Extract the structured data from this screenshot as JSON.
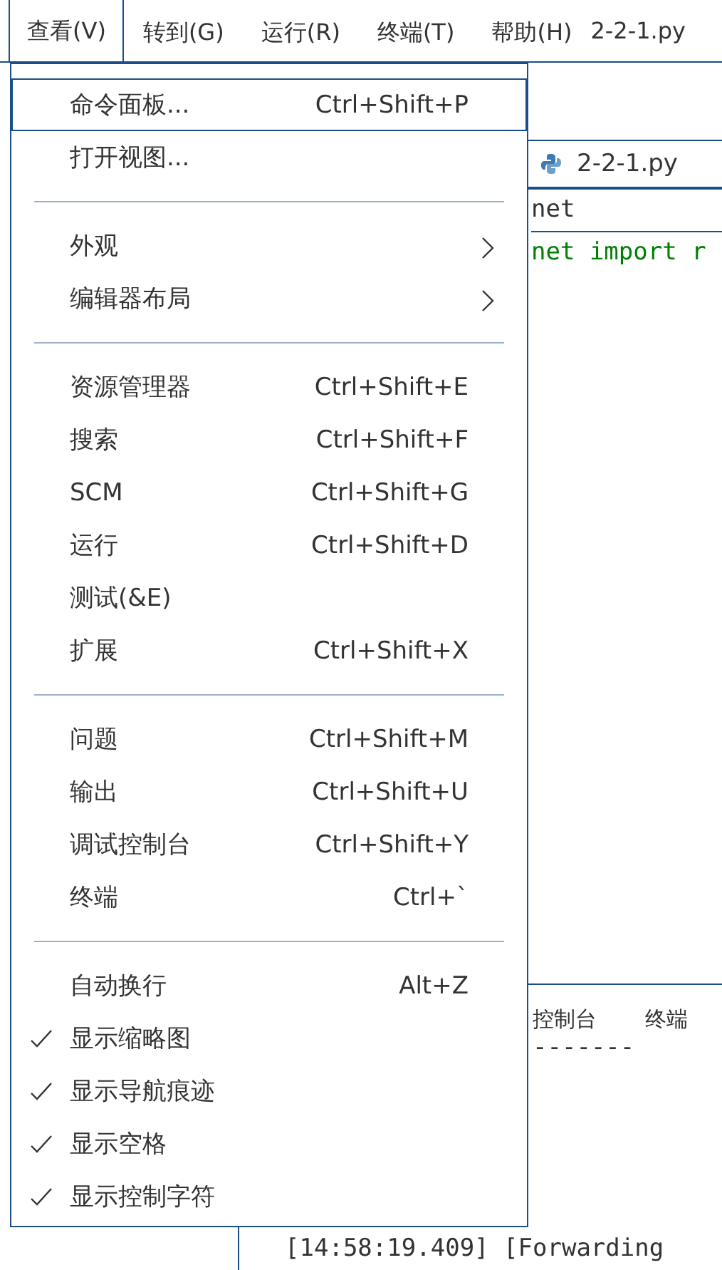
{
  "menubar": [
    {
      "label": "查看(V)",
      "selected": true
    },
    {
      "label": "转到(G)",
      "selected": false
    },
    {
      "label": "运行(R)",
      "selected": false
    },
    {
      "label": "终端(T)",
      "selected": false
    },
    {
      "label": "帮助(H)",
      "selected": false
    }
  ],
  "window": {
    "title": "2-2-1.py"
  },
  "editor": {
    "tab": "2-2-1.py",
    "lines": [
      "net",
      "net import r"
    ]
  },
  "panel": {
    "tabs": [
      "控制台",
      "终端"
    ],
    "lines": [
      "-------",
      "[14:58:19.409] [Forwarding"
    ]
  },
  "menu": {
    "groups": [
      {
        "items": [
          {
            "label": "命令面板...",
            "shortcut": "Ctrl+Shift+P",
            "kind": "command",
            "selected": true,
            "checked": false
          },
          {
            "label": "打开视图...",
            "kind": "command",
            "selected": false,
            "checked": false
          }
        ]
      },
      {
        "items": [
          {
            "label": "外观",
            "kind": "submenu",
            "selected": false,
            "checked": false
          },
          {
            "label": "编辑器布局",
            "kind": "submenu",
            "selected": false,
            "checked": false
          }
        ]
      },
      {
        "items": [
          {
            "label": "资源管理器",
            "shortcut": "Ctrl+Shift+E",
            "kind": "command",
            "selected": false,
            "checked": false
          },
          {
            "label": "搜索",
            "shortcut": "Ctrl+Shift+F",
            "kind": "command",
            "selected": false,
            "checked": false
          },
          {
            "label": "SCM",
            "shortcut": "Ctrl+Shift+G",
            "kind": "command",
            "selected": false,
            "checked": false
          },
          {
            "label": "运行",
            "shortcut": "Ctrl+Shift+D",
            "kind": "command",
            "selected": false,
            "checked": false
          },
          {
            "label": "测试(&E)",
            "kind": "command",
            "selected": false,
            "checked": false
          },
          {
            "label": "扩展",
            "shortcut": "Ctrl+Shift+X",
            "kind": "command",
            "selected": false,
            "checked": false
          }
        ]
      },
      {
        "items": [
          {
            "label": "问题",
            "shortcut": "Ctrl+Shift+M",
            "kind": "command",
            "selected": false,
            "checked": false
          },
          {
            "label": "输出",
            "shortcut": "Ctrl+Shift+U",
            "kind": "command",
            "selected": false,
            "checked": false
          },
          {
            "label": "调试控制台",
            "shortcut": "Ctrl+Shift+Y",
            "kind": "command",
            "selected": false,
            "checked": false
          },
          {
            "label": "终端",
            "shortcut": "Ctrl+`",
            "kind": "command",
            "selected": false,
            "checked": false
          }
        ]
      },
      {
        "items": [
          {
            "label": "自动换行",
            "shortcut": "Alt+Z",
            "kind": "command",
            "selected": false,
            "checked": false
          },
          {
            "label": "显示缩略图",
            "kind": "command",
            "selected": false,
            "checked": true
          },
          {
            "label": "显示导航痕迹",
            "kind": "command",
            "selected": false,
            "checked": true
          },
          {
            "label": "显示空格",
            "kind": "command",
            "selected": false,
            "checked": true
          },
          {
            "label": "显示控制字符",
            "kind": "command",
            "selected": false,
            "checked": true
          }
        ]
      }
    ]
  }
}
